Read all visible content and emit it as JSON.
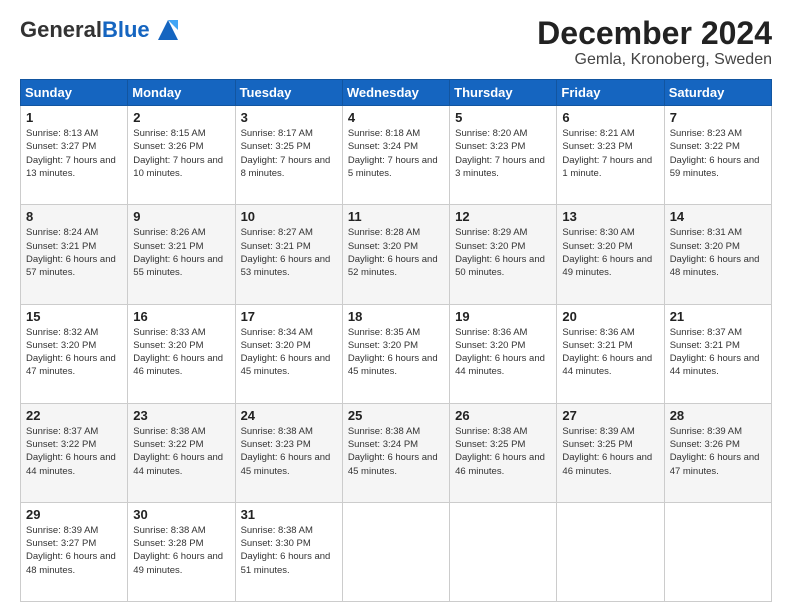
{
  "header": {
    "logo_general": "General",
    "logo_blue": "Blue",
    "title": "December 2024",
    "subtitle": "Gemla, Kronoberg, Sweden"
  },
  "calendar": {
    "days_of_week": [
      "Sunday",
      "Monday",
      "Tuesday",
      "Wednesday",
      "Thursday",
      "Friday",
      "Saturday"
    ],
    "weeks": [
      [
        {
          "day": "1",
          "sunrise": "8:13 AM",
          "sunset": "3:27 PM",
          "daylight": "7 hours and 13 minutes."
        },
        {
          "day": "2",
          "sunrise": "8:15 AM",
          "sunset": "3:26 PM",
          "daylight": "7 hours and 10 minutes."
        },
        {
          "day": "3",
          "sunrise": "8:17 AM",
          "sunset": "3:25 PM",
          "daylight": "7 hours and 8 minutes."
        },
        {
          "day": "4",
          "sunrise": "8:18 AM",
          "sunset": "3:24 PM",
          "daylight": "7 hours and 5 minutes."
        },
        {
          "day": "5",
          "sunrise": "8:20 AM",
          "sunset": "3:23 PM",
          "daylight": "7 hours and 3 minutes."
        },
        {
          "day": "6",
          "sunrise": "8:21 AM",
          "sunset": "3:23 PM",
          "daylight": "7 hours and 1 minute."
        },
        {
          "day": "7",
          "sunrise": "8:23 AM",
          "sunset": "3:22 PM",
          "daylight": "6 hours and 59 minutes."
        }
      ],
      [
        {
          "day": "8",
          "sunrise": "8:24 AM",
          "sunset": "3:21 PM",
          "daylight": "6 hours and 57 minutes."
        },
        {
          "day": "9",
          "sunrise": "8:26 AM",
          "sunset": "3:21 PM",
          "daylight": "6 hours and 55 minutes."
        },
        {
          "day": "10",
          "sunrise": "8:27 AM",
          "sunset": "3:21 PM",
          "daylight": "6 hours and 53 minutes."
        },
        {
          "day": "11",
          "sunrise": "8:28 AM",
          "sunset": "3:20 PM",
          "daylight": "6 hours and 52 minutes."
        },
        {
          "day": "12",
          "sunrise": "8:29 AM",
          "sunset": "3:20 PM",
          "daylight": "6 hours and 50 minutes."
        },
        {
          "day": "13",
          "sunrise": "8:30 AM",
          "sunset": "3:20 PM",
          "daylight": "6 hours and 49 minutes."
        },
        {
          "day": "14",
          "sunrise": "8:31 AM",
          "sunset": "3:20 PM",
          "daylight": "6 hours and 48 minutes."
        }
      ],
      [
        {
          "day": "15",
          "sunrise": "8:32 AM",
          "sunset": "3:20 PM",
          "daylight": "6 hours and 47 minutes."
        },
        {
          "day": "16",
          "sunrise": "8:33 AM",
          "sunset": "3:20 PM",
          "daylight": "6 hours and 46 minutes."
        },
        {
          "day": "17",
          "sunrise": "8:34 AM",
          "sunset": "3:20 PM",
          "daylight": "6 hours and 45 minutes."
        },
        {
          "day": "18",
          "sunrise": "8:35 AM",
          "sunset": "3:20 PM",
          "daylight": "6 hours and 45 minutes."
        },
        {
          "day": "19",
          "sunrise": "8:36 AM",
          "sunset": "3:20 PM",
          "daylight": "6 hours and 44 minutes."
        },
        {
          "day": "20",
          "sunrise": "8:36 AM",
          "sunset": "3:21 PM",
          "daylight": "6 hours and 44 minutes."
        },
        {
          "day": "21",
          "sunrise": "8:37 AM",
          "sunset": "3:21 PM",
          "daylight": "6 hours and 44 minutes."
        }
      ],
      [
        {
          "day": "22",
          "sunrise": "8:37 AM",
          "sunset": "3:22 PM",
          "daylight": "6 hours and 44 minutes."
        },
        {
          "day": "23",
          "sunrise": "8:38 AM",
          "sunset": "3:22 PM",
          "daylight": "6 hours and 44 minutes."
        },
        {
          "day": "24",
          "sunrise": "8:38 AM",
          "sunset": "3:23 PM",
          "daylight": "6 hours and 45 minutes."
        },
        {
          "day": "25",
          "sunrise": "8:38 AM",
          "sunset": "3:24 PM",
          "daylight": "6 hours and 45 minutes."
        },
        {
          "day": "26",
          "sunrise": "8:38 AM",
          "sunset": "3:25 PM",
          "daylight": "6 hours and 46 minutes."
        },
        {
          "day": "27",
          "sunrise": "8:39 AM",
          "sunset": "3:25 PM",
          "daylight": "6 hours and 46 minutes."
        },
        {
          "day": "28",
          "sunrise": "8:39 AM",
          "sunset": "3:26 PM",
          "daylight": "6 hours and 47 minutes."
        }
      ],
      [
        {
          "day": "29",
          "sunrise": "8:39 AM",
          "sunset": "3:27 PM",
          "daylight": "6 hours and 48 minutes."
        },
        {
          "day": "30",
          "sunrise": "8:38 AM",
          "sunset": "3:28 PM",
          "daylight": "6 hours and 49 minutes."
        },
        {
          "day": "31",
          "sunrise": "8:38 AM",
          "sunset": "3:30 PM",
          "daylight": "6 hours and 51 minutes."
        },
        null,
        null,
        null,
        null
      ]
    ]
  }
}
